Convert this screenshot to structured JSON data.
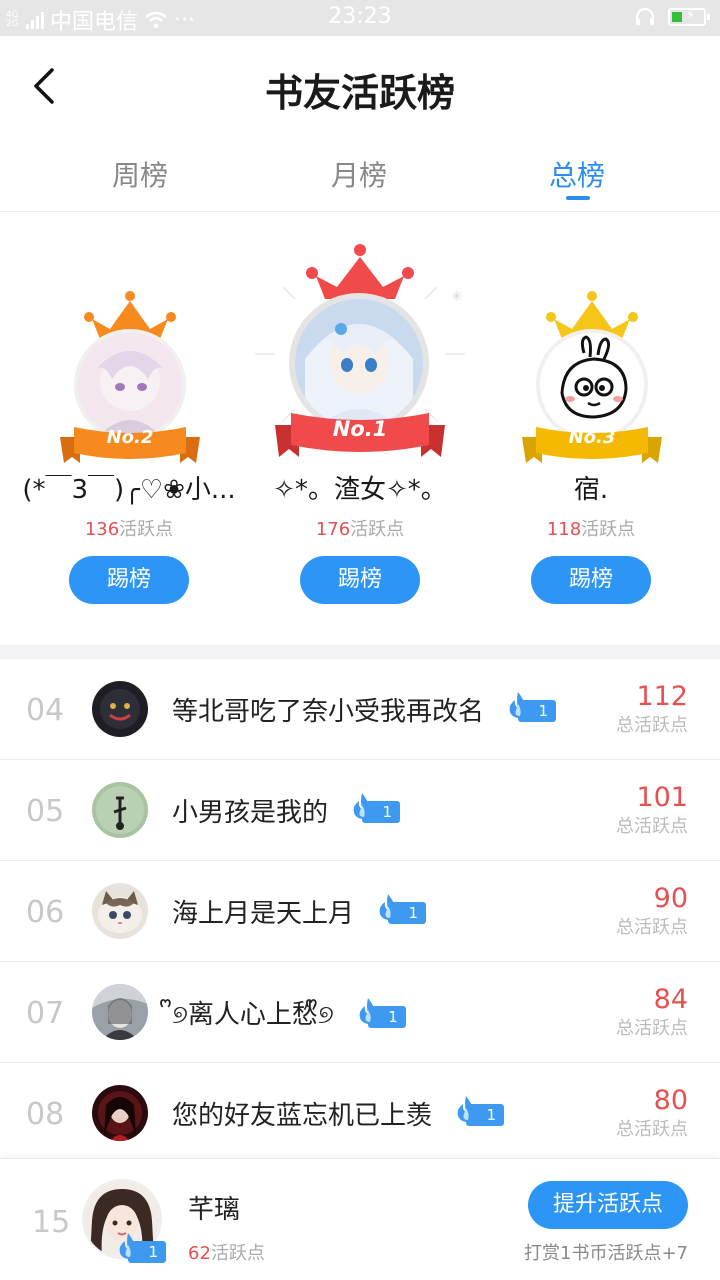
{
  "status_bar": {
    "network": "4G 2G",
    "carrier": "中国电信",
    "more": "···",
    "time": "23:23"
  },
  "header": {
    "title": "书友活跃榜"
  },
  "tabs": [
    {
      "label": "周榜",
      "active": false
    },
    {
      "label": "月榜",
      "active": false
    },
    {
      "label": "总榜",
      "active": true
    }
  ],
  "podium": {
    "second": {
      "badge": "No.2",
      "name": "(*￣3￣)╭♡❀小...",
      "points": "136",
      "points_unit": "活跃点",
      "button": "踢榜"
    },
    "first": {
      "badge": "No.1",
      "name": "✧*。渣女✧*。",
      "points": "176",
      "points_unit": "活跃点",
      "button": "踢榜"
    },
    "third": {
      "badge": "No.3",
      "name": "宿.",
      "points": "118",
      "points_unit": "活跃点",
      "button": "踢榜"
    }
  },
  "list": [
    {
      "rank": "04",
      "name": "等北哥吃了奈小受我再改名",
      "level": "1",
      "score": "112",
      "score_label": "总活跃点"
    },
    {
      "rank": "05",
      "name": "小男孩是我的",
      "level": "1",
      "score": "101",
      "score_label": "总活跃点"
    },
    {
      "rank": "06",
      "name": "海上月是天上月",
      "level": "1",
      "score": "90",
      "score_label": "总活跃点"
    },
    {
      "rank": "07",
      "name": "ᩚ୭离人心上愁ᩚ୭",
      "level": "1",
      "score": "84",
      "score_label": "总活跃点"
    },
    {
      "rank": "08",
      "name": "您的好友蓝忘机已上羡",
      "level": "1",
      "score": "80",
      "score_label": "总活跃点"
    }
  ],
  "me": {
    "rank": "15",
    "name": "芊璃",
    "level": "1",
    "points": "62",
    "points_unit": "活跃点",
    "boost_button": "提升活跃点",
    "boost_note": "打赏1书币活跃点+7"
  },
  "colors": {
    "accent": "#2d95f5",
    "score": "#e65050",
    "gold": "#f5a623",
    "crown_red": "#f04a4a",
    "orange": "#f78a1e"
  }
}
